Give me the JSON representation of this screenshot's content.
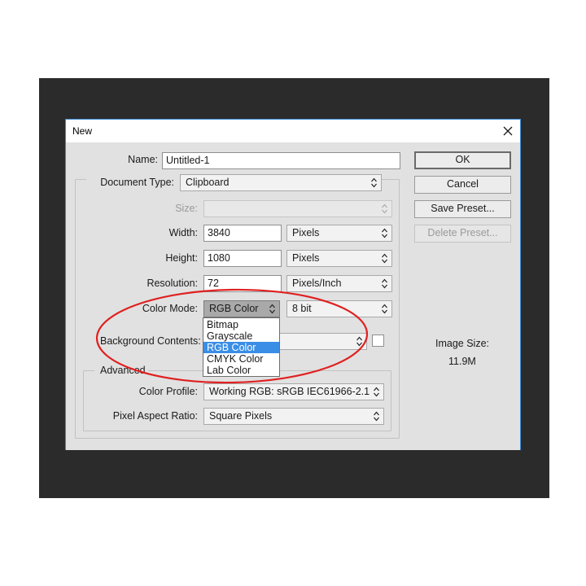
{
  "dialog": {
    "title": "New"
  },
  "form": {
    "name_label": "Name:",
    "name_value": "Untitled-1",
    "doc_type_label": "Document Type:",
    "doc_type_value": "Clipboard",
    "size_label": "Size:",
    "size_value": "",
    "width_label": "Width:",
    "width_value": "3840",
    "width_unit": "Pixels",
    "height_label": "Height:",
    "height_value": "1080",
    "height_unit": "Pixels",
    "resolution_label": "Resolution:",
    "resolution_value": "72",
    "resolution_unit": "Pixels/Inch",
    "color_mode_label": "Color Mode:",
    "color_mode_value": "RGB Color",
    "bit_depth_value": "8 bit",
    "background_label": "Background Contents:",
    "background_value": "",
    "advanced_label": "Advanced",
    "color_profile_label": "Color Profile:",
    "color_profile_value": "Working RGB:  sRGB IEC61966-2.1",
    "pixel_aspect_label": "Pixel Aspect Ratio:",
    "pixel_aspect_value": "Square Pixels"
  },
  "color_mode_options": [
    "Bitmap",
    "Grayscale",
    "RGB Color",
    "CMYK Color",
    "Lab Color"
  ],
  "color_mode_selected": "RGB Color",
  "buttons": {
    "ok": "OK",
    "cancel": "Cancel",
    "save_preset": "Save Preset...",
    "delete_preset": "Delete Preset..."
  },
  "image_size": {
    "label": "Image Size:",
    "value": "11.9M"
  },
  "colors": {
    "backdrop": "#2b2b2b",
    "dialog_border": "#3c8bd6",
    "selection": "#3a8ee6",
    "annotation": "#e02020"
  }
}
